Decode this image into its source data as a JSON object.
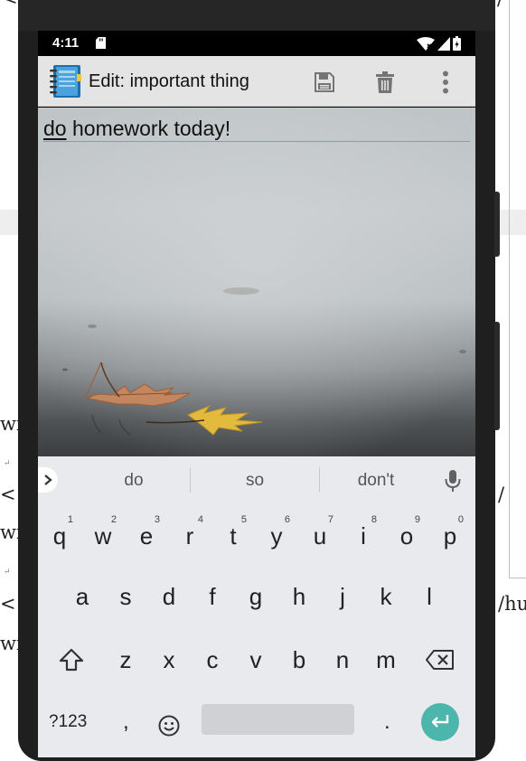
{
  "background_document": {
    "fragments": [
      "<",
      "/",
      "wi",
      "<",
      "/",
      "wi",
      "<",
      "/hu",
      "wi"
    ]
  },
  "status_bar": {
    "time": "4:11"
  },
  "app_bar": {
    "title": "Edit: important thing",
    "actions": {
      "save": "floppy-disk-icon",
      "delete": "trash-icon",
      "more": "overflow-menu-icon"
    }
  },
  "note": {
    "first_word": "do",
    "rest": " homework today!"
  },
  "keyboard": {
    "suggestions": [
      "do",
      "so",
      "don't"
    ],
    "row1": [
      {
        "label": "q",
        "hint": "1"
      },
      {
        "label": "w",
        "hint": "2"
      },
      {
        "label": "e",
        "hint": "3"
      },
      {
        "label": "r",
        "hint": "4"
      },
      {
        "label": "t",
        "hint": "5"
      },
      {
        "label": "y",
        "hint": "6"
      },
      {
        "label": "u",
        "hint": "7"
      },
      {
        "label": "i",
        "hint": "8"
      },
      {
        "label": "o",
        "hint": "9"
      },
      {
        "label": "p",
        "hint": "0"
      }
    ],
    "row2": [
      "a",
      "s",
      "d",
      "f",
      "g",
      "h",
      "j",
      "k",
      "l"
    ],
    "row3": [
      "z",
      "x",
      "c",
      "v",
      "b",
      "n",
      "m"
    ],
    "symbols_label": "?123",
    "comma": ",",
    "period": ".",
    "accent_color": "#4db6ac"
  }
}
